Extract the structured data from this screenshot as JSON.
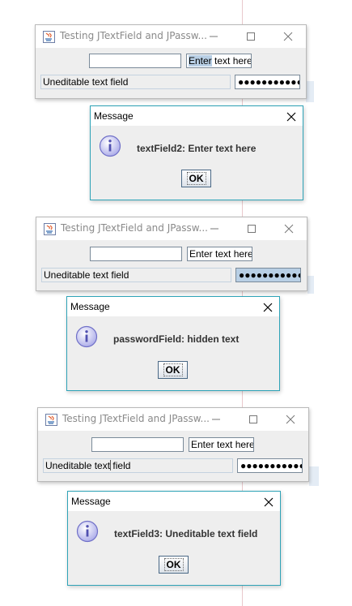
{
  "colors": {
    "dialog_border": "#2ea3b7",
    "selection": "#b8cfe5",
    "info_icon": "#8a8ad8"
  },
  "screenshots": [
    {
      "window": {
        "title": "Testing JTextField and JPassw...",
        "textfield1_value": "",
        "textfield2_value": "Enter text here",
        "textfield2_selected_part": "Enter",
        "textfield2_rest": " text here",
        "uneditable_value": "Uneditable text field",
        "password_mask": "●●●●●●●●●●●"
      },
      "dialog": {
        "title": "Message",
        "message": "textField2: Enter text here",
        "ok_label": "OK"
      }
    },
    {
      "window": {
        "title": "Testing JTextField and JPassw...",
        "textfield1_value": "",
        "textfield2_value": "Enter text here",
        "uneditable_value": "Uneditable text field",
        "password_mask": "●●●●●●●●●●●"
      },
      "dialog": {
        "title": "Message",
        "message": "passwordField: hidden text",
        "ok_label": "OK"
      }
    },
    {
      "window": {
        "title": "Testing JTextField and JPassw...",
        "textfield1_value": "",
        "textfield2_value": "Enter text here",
        "uneditable_value_part1": "Uneditable text",
        "uneditable_value_part2": " field",
        "password_mask": "●●●●●●●●●●●"
      },
      "dialog": {
        "title": "Message",
        "message": "textField3: Uneditable text field",
        "ok_label": "OK"
      }
    }
  ]
}
